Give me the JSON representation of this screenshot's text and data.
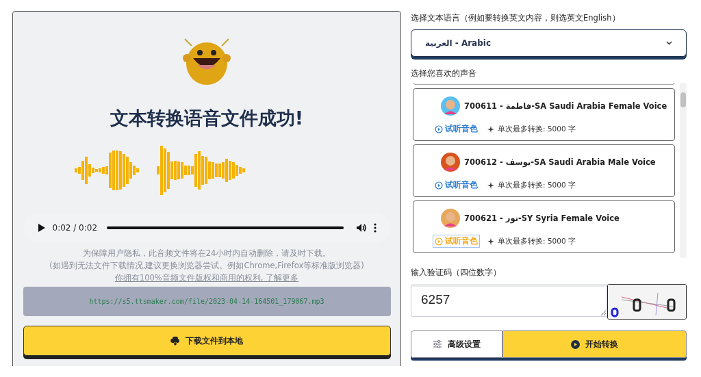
{
  "result": {
    "title": "文本转换语音文件成功!",
    "player": {
      "time": "0:02 / 0:02",
      "level": 1.0
    },
    "notes": [
      "为保障用户隐私，此音频文件将在24小时内自动删除，请及时下载。",
      "(如遇到无法文件下载情况,建议更换浏览器尝试。例如Chrome,Firefox等标准版浏览器)"
    ],
    "rights_link": "你拥有100%音频文件版权和商用的权利, 了解更多",
    "file_url": "https://s5.ttsmaker.com/file/2023-04-14-164501_179067.mp3",
    "download_button": "下载文件到本地"
  },
  "language": {
    "label": "选择文本语言（例如要转换英文内容，则选英文English）",
    "value": "العربية - Arabic"
  },
  "voices": {
    "label": "选择您喜欢的声音",
    "items": [
      {
        "title": "700611 - فاطمة-SA Saudi Arabia Female Voice",
        "preview": "试听音色",
        "limit": "单次最多转换: 5000 字",
        "playing": false
      },
      {
        "title": "700612 - يوسف-SA Saudi Arabia Male Voice",
        "preview": "试听音色",
        "limit": "单次最多转换: 5000 字",
        "playing": false
      },
      {
        "title": "700621 - نور-SY Syria Female Voice",
        "preview": "试听音色",
        "limit": "单次最多转换: 5000 字",
        "playing": true
      }
    ]
  },
  "captcha": {
    "label": "输入验证码（四位数字）",
    "value": "6257"
  },
  "buttons": {
    "settings": "高级设置",
    "start": "开始转换"
  }
}
